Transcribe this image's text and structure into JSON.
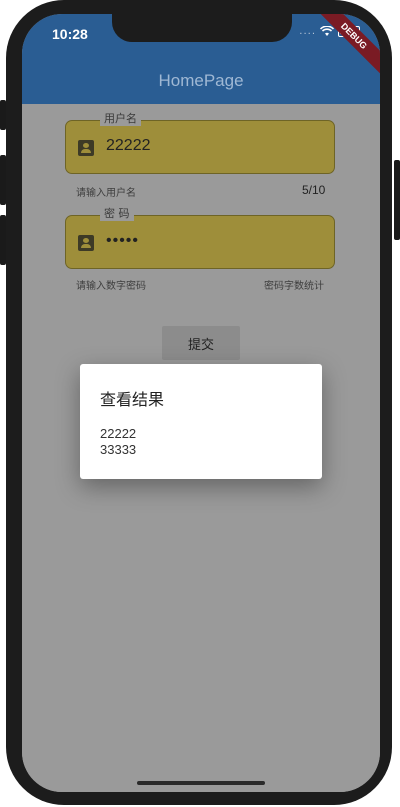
{
  "status_bar": {
    "time": "10:28",
    "signal": "....",
    "debug_label": "DEBUG"
  },
  "app_bar": {
    "title": "HomePage"
  },
  "username_field": {
    "label": "用户名",
    "value": "22222",
    "helper": "请输入用户名",
    "counter": "5/10",
    "icon": "account-box-icon"
  },
  "password_field": {
    "label": "密 码",
    "value": "•••••",
    "helper": "请输入数字密码",
    "counter": "密码字数统计",
    "icon": "account-box-icon"
  },
  "submit_button": {
    "label": "提交"
  },
  "dialog": {
    "title": "查看结果",
    "lines": [
      "22222",
      "33333"
    ]
  },
  "colors": {
    "app_bar": "#2a5d93",
    "field_fill": "#9e8e3a",
    "overlay": "#9a9a9a",
    "dialog_bg": "#ffffff"
  }
}
